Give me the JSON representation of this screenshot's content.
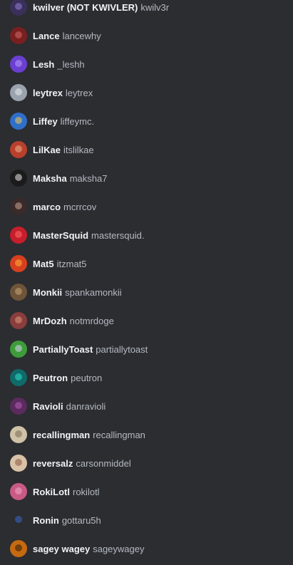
{
  "members": [
    {
      "display_name": "kwilver (NOT KWIVLER)",
      "username": "kwilv3r",
      "avatar": {
        "bg": "#3b2f5c",
        "fg": "#8f7fd1"
      }
    },
    {
      "display_name": "Lance",
      "username": "lancewhy",
      "avatar": {
        "bg": "#7a1f1f",
        "fg": "#d06a6a"
      }
    },
    {
      "display_name": "Lesh",
      "username": "_leshh",
      "avatar": {
        "bg": "#6b3fd1",
        "fg": "#b89bff"
      }
    },
    {
      "display_name": "leytrex",
      "username": "leytrex",
      "avatar": {
        "bg": "#9aa3ad",
        "fg": "#e7ebef"
      }
    },
    {
      "display_name": "Liffey",
      "username": "liffeymc.",
      "avatar": {
        "bg": "#2f6fc9",
        "fg": "#f1c94f"
      }
    },
    {
      "display_name": "LilKae",
      "username": "itslilkae",
      "avatar": {
        "bg": "#b8402c",
        "fg": "#e9b08a"
      }
    },
    {
      "display_name": "Maksha",
      "username": "maksha7",
      "avatar": {
        "bg": "#1b1b1b",
        "fg": "#e8e8e8"
      }
    },
    {
      "display_name": "marco",
      "username": "mcrrcov",
      "avatar": {
        "bg": "#3a2a2a",
        "fg": "#c9a48f"
      }
    },
    {
      "display_name": "MasterSquid",
      "username": "mastersquid.",
      "avatar": {
        "bg": "#c61e2a",
        "fg": "#ff6b6b"
      }
    },
    {
      "display_name": "Mat5",
      "username": "itzmat5",
      "avatar": {
        "bg": "#d7401f",
        "fg": "#ffb13b"
      }
    },
    {
      "display_name": "Monkii",
      "username": "spankamonkii",
      "avatar": {
        "bg": "#6e5438",
        "fg": "#c8a67a"
      }
    },
    {
      "display_name": "MrDozh",
      "username": "notmrdoge",
      "avatar": {
        "bg": "#8a3d3d",
        "fg": "#d89a7a"
      }
    },
    {
      "display_name": "PartiallyToast",
      "username": "partiallytoast",
      "avatar": {
        "bg": "#3e9b3a",
        "fg": "#d9d4f2"
      }
    },
    {
      "display_name": "Peutron",
      "username": "peutron",
      "avatar": {
        "bg": "#0f6a6a",
        "fg": "#2ee0c8"
      }
    },
    {
      "display_name": "Ravioli",
      "username": "danravioli",
      "avatar": {
        "bg": "#5b2a5e",
        "fg": "#b75fb8"
      }
    },
    {
      "display_name": "recallingman",
      "username": "recallingman",
      "avatar": {
        "bg": "#cfc2a6",
        "fg": "#7a6a52"
      }
    },
    {
      "display_name": "reversalz",
      "username": "carsonmiddel",
      "avatar": {
        "bg": "#d9c2a8",
        "fg": "#8a5a3c"
      }
    },
    {
      "display_name": "RokiLotl",
      "username": "rokilotl",
      "avatar": {
        "bg": "#c85a86",
        "fg": "#f0a9c4"
      }
    },
    {
      "display_name": "Ronin",
      "username": "gottaru5h",
      "avatar": {
        "bg": "#2b2d31",
        "fg": "#3a68c9"
      }
    },
    {
      "display_name": "sagey wagey",
      "username": "sageywagey",
      "avatar": {
        "bg": "#c56a10",
        "fg": "#2b1a08"
      }
    }
  ]
}
